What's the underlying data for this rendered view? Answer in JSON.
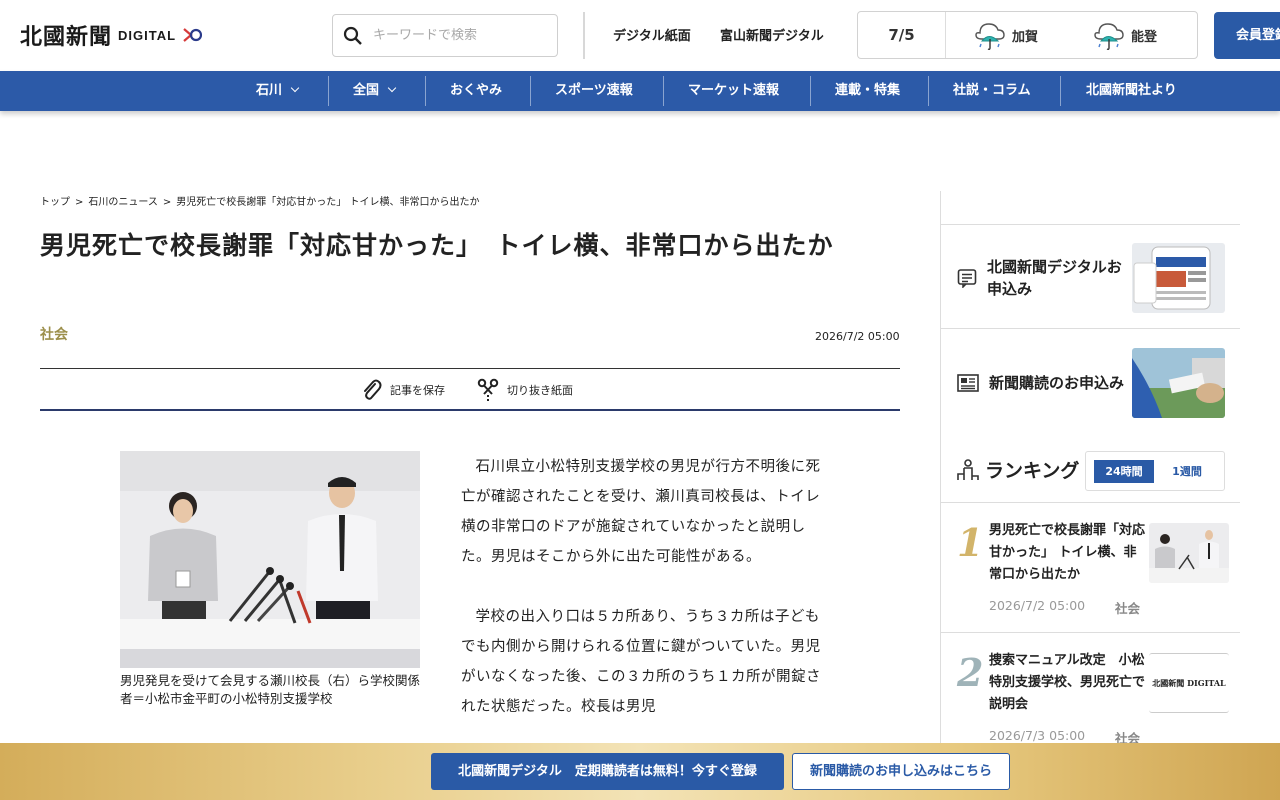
{
  "header": {
    "logo_kanji": "北國新聞",
    "logo_digital": "DIGITAL",
    "search_placeholder": "キーワードで検索",
    "links": [
      "デジタル紙面",
      "富山新聞デジタル"
    ],
    "weather": {
      "date": "7/5",
      "locations": [
        {
          "name": "加賀",
          "icon": "rain-umbrella-icon"
        },
        {
          "name": "能登",
          "icon": "rain-umbrella-icon"
        }
      ]
    },
    "member_button": "会員登録"
  },
  "nav": {
    "items": [
      {
        "label": "石川",
        "dropdown": true
      },
      {
        "label": "全国",
        "dropdown": true
      },
      {
        "label": "おくやみ"
      },
      {
        "label": "スポーツ速報"
      },
      {
        "label": "マーケット速報"
      },
      {
        "label": "連載・特集"
      },
      {
        "label": "社説・コラム"
      },
      {
        "label": "北國新聞社より"
      }
    ]
  },
  "breadcrumb": [
    "トップ",
    "石川のニュース",
    "男児死亡で校長謝罪「対応甘かった」 トイレ横、非常口から出たか"
  ],
  "article": {
    "title": "男児死亡で校長謝罪「対応甘かった」　トイレ横、非常口から出たか",
    "category": "社会",
    "date": "2026/7/2 05:00",
    "actions": {
      "save": "記事を保存",
      "clip": "切り抜き紙面"
    },
    "photo_caption": "男児発見を受けて会見する瀬川校長（右）ら学校関係者＝小松市金平町の小松特別支援学校",
    "paragraphs": [
      "石川県立小松特別支援学校の男児が行方不明後に死亡が確認されたことを受け、瀬川真司校長は、トイレ横の非常口のドアが施錠されていなかったと説明した。男児はそこから外に出た可能性がある。",
      "学校の出入り口は５カ所あり、うち３カ所は子どもでも内側から開けられる位置に鍵がついていた。男児がいなくなった後、この３カ所のうち１カ所が開錠された状態だった。校長は男児"
    ]
  },
  "sidebar": {
    "promos": [
      {
        "text": "北國新聞デジタルお申込み",
        "icon": "document-list-icon"
      },
      {
        "text": "新聞購読のお申込み",
        "icon": "newspaper-icon"
      }
    ],
    "ranking": {
      "title": "ランキング",
      "tabs": [
        "24時間",
        "1週間"
      ],
      "items": [
        {
          "rank": "1",
          "headline": "男児死亡で校長謝罪「対応甘かった」 トイレ横、非常口から出たか",
          "date": "2026/7/2 05:00",
          "category": "社会"
        },
        {
          "rank": "2",
          "headline": "捜索マニュアル改定　小松特別支援学校、男児死亡で説明会",
          "date": "2026/7/3 05:00",
          "category": "社会",
          "thumb_text": "北國新聞 DIGITAL"
        }
      ]
    }
  },
  "bottom_bar": {
    "primary": "北國新聞デジタル　定期購読者は無料！今すぐ登録",
    "secondary": "新聞購読のお申し込みはこちら"
  },
  "colors": {
    "brand_blue": "#2c5aa8",
    "gold": "#d2b46a",
    "category": "#9c8f4b"
  }
}
